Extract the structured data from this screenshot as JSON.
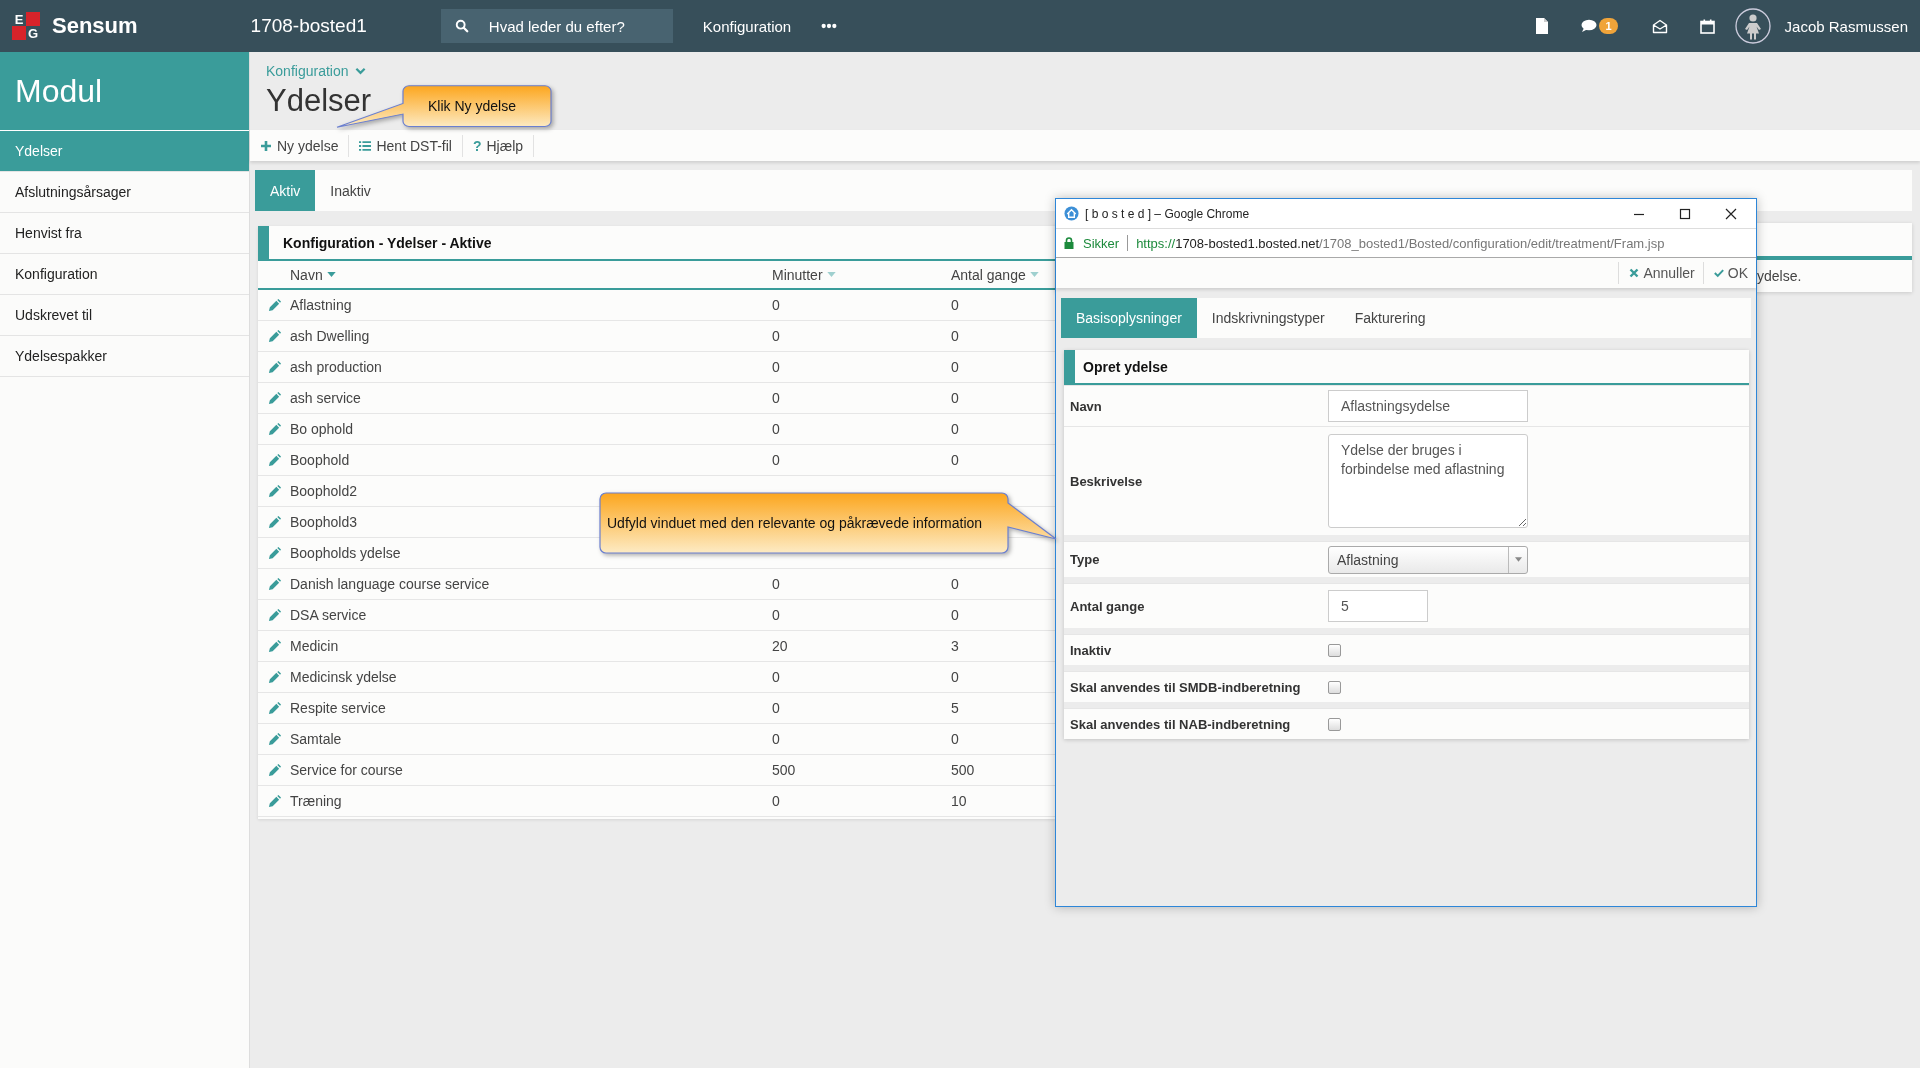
{
  "topbar": {
    "logo": [
      "E",
      "G"
    ],
    "brand": "Sensum",
    "site": "1708-bosted1",
    "search": {
      "placeholder": "Hvad leder du efter?"
    },
    "nav": [
      "Konfiguration"
    ],
    "badge": "1",
    "user": "Jacob Rasmussen"
  },
  "sidebar": {
    "title": "Modul",
    "items": [
      {
        "label": "Ydelser",
        "selected": true
      },
      {
        "label": "Afslutningsårsager",
        "selected": false
      },
      {
        "label": "Henvist fra",
        "selected": false
      },
      {
        "label": "Konfiguration",
        "selected": false
      },
      {
        "label": "Udskrevet til",
        "selected": false
      },
      {
        "label": "Ydelsespakker",
        "selected": false
      }
    ]
  },
  "breadcrumb": "Konfiguration",
  "title": "Ydelser",
  "toolbar": [
    {
      "label": "Ny ydelse",
      "kind": "plus"
    },
    {
      "label": "Hent DST-fil",
      "kind": "list"
    },
    {
      "label": "Hjælp",
      "kind": "help",
      "glyph": "?"
    }
  ],
  "tabs": [
    {
      "label": "Aktiv",
      "selected": true
    },
    {
      "label": "Inaktiv",
      "selected": false
    }
  ],
  "table": {
    "title": "Konfiguration - Ydelser - Aktive",
    "columns": [
      {
        "label": "Navn",
        "sorted": true
      },
      {
        "label": "Minutter",
        "sorted": false
      },
      {
        "label": "Antal gange",
        "sorted": false
      }
    ],
    "rows": [
      {
        "name": "Aflastning",
        "minutter": "0",
        "antal_gange": "0"
      },
      {
        "name": "ash Dwelling",
        "minutter": "0",
        "antal_gange": "0"
      },
      {
        "name": "ash production",
        "minutter": "0",
        "antal_gange": "0"
      },
      {
        "name": "ash service",
        "minutter": "0",
        "antal_gange": "0"
      },
      {
        "name": "Bo ophold",
        "minutter": "0",
        "antal_gange": "0"
      },
      {
        "name": "Boophold",
        "minutter": "0",
        "antal_gange": "0"
      },
      {
        "name": "Boophold2"
      },
      {
        "name": "Boophold3"
      },
      {
        "name": "Boopholds ydelse"
      },
      {
        "name": "Danish language course service",
        "minutter": "0",
        "antal_gange": "0"
      },
      {
        "name": "DSA service",
        "minutter": "0",
        "antal_gange": "0"
      },
      {
        "name": "Medicin",
        "minutter": "20",
        "antal_gange": "3"
      },
      {
        "name": "Medicinsk ydelse",
        "minutter": "0",
        "antal_gange": "0"
      },
      {
        "name": "Respite service",
        "minutter": "0",
        "antal_gange": "5"
      },
      {
        "name": "Samtale",
        "minutter": "0",
        "antal_gange": "0"
      },
      {
        "name": "Service for course",
        "minutter": "500",
        "antal_gange": "500"
      },
      {
        "name": "Træning",
        "minutter": "0",
        "antal_gange": "10"
      }
    ]
  },
  "notice": {
    "text": "ydelse."
  },
  "popup": {
    "title": "[ b o s t e d ] – Google Chrome",
    "secure_label": "Sikker",
    "url": {
      "scheme": "https://",
      "host": "1708-bosted1.bosted.net",
      "path": "/1708_bosted1/Bosted/configuration/edit/treatment/Fram.jsp"
    },
    "actions": [
      {
        "label": "Annuller",
        "kind": "cancel"
      },
      {
        "label": "OK",
        "kind": "ok"
      }
    ],
    "tabs": [
      {
        "label": "Basisoplysninger",
        "selected": true
      },
      {
        "label": "Indskrivningstyper",
        "selected": false
      },
      {
        "label": "Fakturering",
        "selected": false
      }
    ],
    "form": {
      "title": "Opret ydelse",
      "fields": [
        {
          "label": "Navn",
          "kind": "text",
          "value": "Aflastningsydelse"
        },
        {
          "label": "Beskrivelse",
          "kind": "textarea",
          "value": "Ydelse der bruges i forbindelse med aflastning"
        },
        {
          "label": "Type",
          "kind": "select",
          "value": "Aflastning"
        },
        {
          "label": "Antal gange",
          "kind": "number",
          "value": "5"
        },
        {
          "label": "Inaktiv",
          "kind": "checkbox",
          "checked": false
        },
        {
          "label": "Skal anvendes til SMDB-indberetning",
          "kind": "checkbox",
          "checked": false
        },
        {
          "label": "Skal anvendes til NAB-indberetning",
          "kind": "checkbox",
          "checked": false
        }
      ]
    }
  },
  "callouts": [
    {
      "text": "Klik Ny ydelse",
      "kind": "tail-left"
    },
    {
      "text": "Udfyld vinduet med den relevante og påkrævede information",
      "kind": "tail-right"
    }
  ]
}
